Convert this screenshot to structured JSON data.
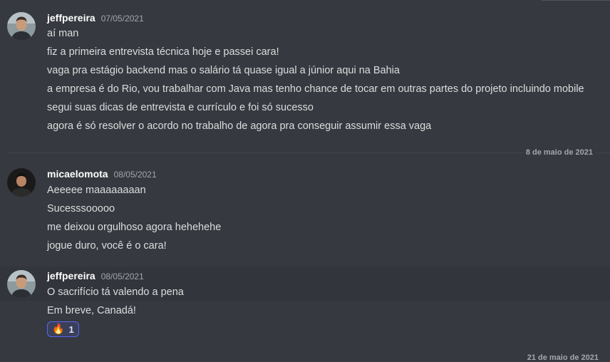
{
  "colors": {
    "background": "#36393f",
    "username": "#ffffff",
    "timestamp": "#a3a6aa",
    "message": "#dcddde",
    "reaction_border": "#5865f2"
  },
  "groups": [
    {
      "username": "jeffpereira",
      "timestamp": "07/05/2021",
      "messages": [
        "aí man",
        "fiz a primeira entrevista técnica hoje e passei cara!",
        "vaga pra estágio backend mas o salário tá quase igual a júnior aqui na Bahia",
        "a empresa é do Rio, vou trabalhar com Java mas tenho chance de tocar em outras partes do projeto incluindo mobile",
        "segui suas dicas de entrevista e currículo e foi só sucesso",
        "agora é só resolver o acordo no trabalho de agora pra conseguir assumir essa vaga"
      ]
    },
    {
      "username": "micaelomota",
      "timestamp": "08/05/2021",
      "messages": [
        "Aeeeee maaaaaaaan",
        "Sucesssooooo",
        "me deixou orgulhoso agora hehehehe",
        "jogue duro, você é o cara!"
      ]
    },
    {
      "username": "jeffpereira",
      "timestamp": "08/05/2021",
      "messages": [
        "O sacrifício tá valendo a pena",
        "Em breve, Canadá!"
      ],
      "reaction": {
        "emoji_icon": "fire-emoji",
        "emoji": "🔥",
        "count": "1"
      }
    }
  ],
  "date_divider": "8 de maio de 2021",
  "date_divider_bottom": "21 de maio de 2021"
}
